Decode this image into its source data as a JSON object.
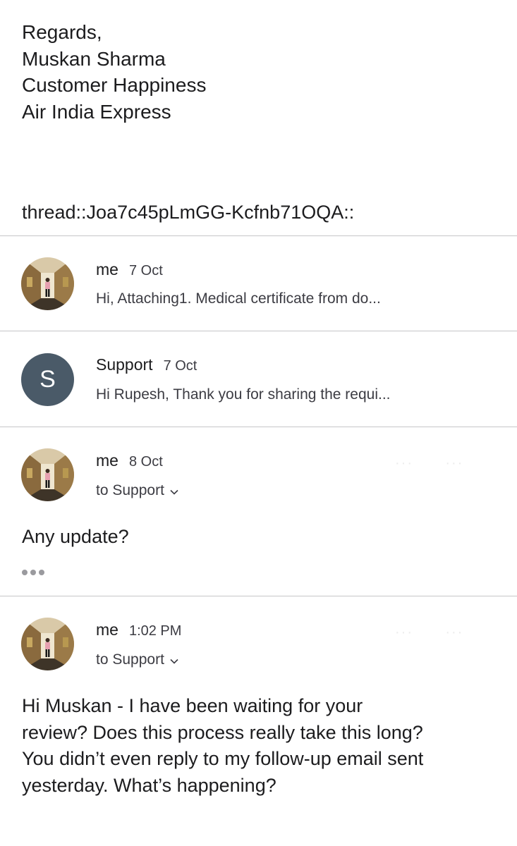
{
  "signature": {
    "lines": [
      "Regards,",
      "Muskan Sharma",
      "Customer Happiness",
      "Air India Express"
    ]
  },
  "thread_id": "thread::Joa7c45pLmGG-Kcfnb71OQA::",
  "messages": [
    {
      "sender": "me",
      "date": "7 Oct",
      "snippet": "Hi, Attaching1. Medical certificate from do...",
      "avatar": "photo-avatar"
    },
    {
      "sender": "Support",
      "date": "7 Oct",
      "snippet": "Hi Rupesh, Thank you for sharing the requi...",
      "avatar_letter": "S",
      "avatar_color": "#4a5a68"
    },
    {
      "sender": "me",
      "date": "8 Oct",
      "to": "to Support",
      "body": "Any update?",
      "avatar": "photo-avatar"
    },
    {
      "sender": "me",
      "date": "1:02 PM",
      "to": "to Support",
      "body_lines": [
        "Hi Muskan - I have been waiting for your",
        "review? Does this process really take this long?",
        "You didn’t even reply to my follow-up email sent",
        "yesterday. What’s happening?"
      ],
      "avatar": "photo-avatar"
    }
  ],
  "icons": {
    "expand": "chevron-down-icon",
    "more": "ellipsis-icon"
  }
}
